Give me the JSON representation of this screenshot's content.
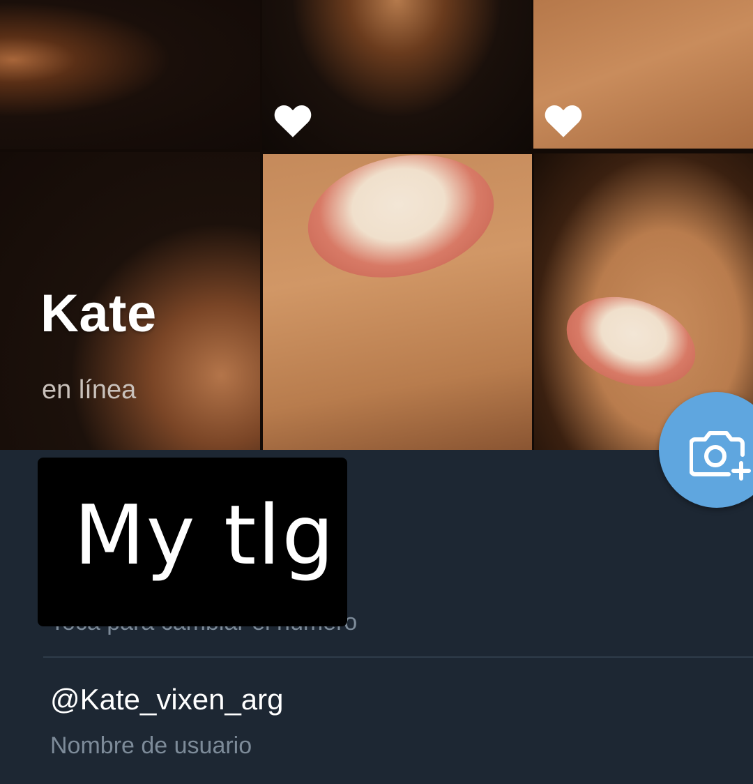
{
  "profile": {
    "name": "Kate",
    "status": "en línea"
  },
  "header": {
    "icons": [
      "heart-icon",
      "heart-icon"
    ]
  },
  "fab": {
    "icon": "camera-add-icon",
    "color": "#5fa6df"
  },
  "info": {
    "phone_hint": "Toca para cambiar el número",
    "username": "@Kate_vixen_arg",
    "username_caption": "Nombre de usuario"
  },
  "overlay": {
    "text": "My tlg"
  },
  "colors": {
    "background": "#1d2733",
    "primary_text": "#ffffff",
    "secondary_text": "#7d8b99",
    "accent": "#5fa6df"
  }
}
